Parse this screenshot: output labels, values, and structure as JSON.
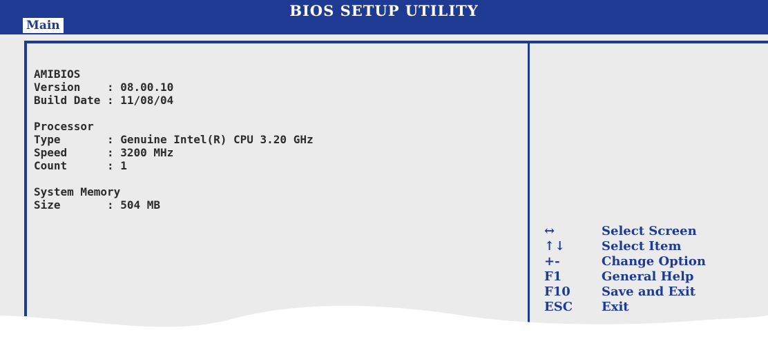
{
  "header": {
    "title": "BIOS SETUP UTILITY",
    "active_tab": "Main"
  },
  "info": {
    "bios": {
      "heading": "AMIBIOS",
      "version_label": "Version    : ",
      "version_value": "08.00.10",
      "build_label": "Build Date : ",
      "build_value": "11/08/04"
    },
    "processor": {
      "heading": "Processor",
      "type_label": "Type       : ",
      "type_value": "Genuine Intel(R) CPU 3.20 GHz",
      "speed_label": "Speed      : ",
      "speed_value": "3200 MHz",
      "count_label": "Count      : ",
      "count_value": "1"
    },
    "memory": {
      "heading": "System Memory",
      "size_label": "Size       : ",
      "size_value": "504 MB"
    }
  },
  "help": [
    {
      "key": "↔",
      "action": "Select Screen"
    },
    {
      "key": "↑↓",
      "action": "Select Item"
    },
    {
      "key": "+-",
      "action": "Change Option"
    },
    {
      "key": "F1",
      "action": "General Help"
    },
    {
      "key": "F10",
      "action": "Save and Exit"
    },
    {
      "key": "ESC",
      "action": "Exit"
    }
  ],
  "colors": {
    "header_blue": "#1f3a93",
    "panel_gray": "#ebebeb",
    "text_dark": "#2b2b2b"
  }
}
